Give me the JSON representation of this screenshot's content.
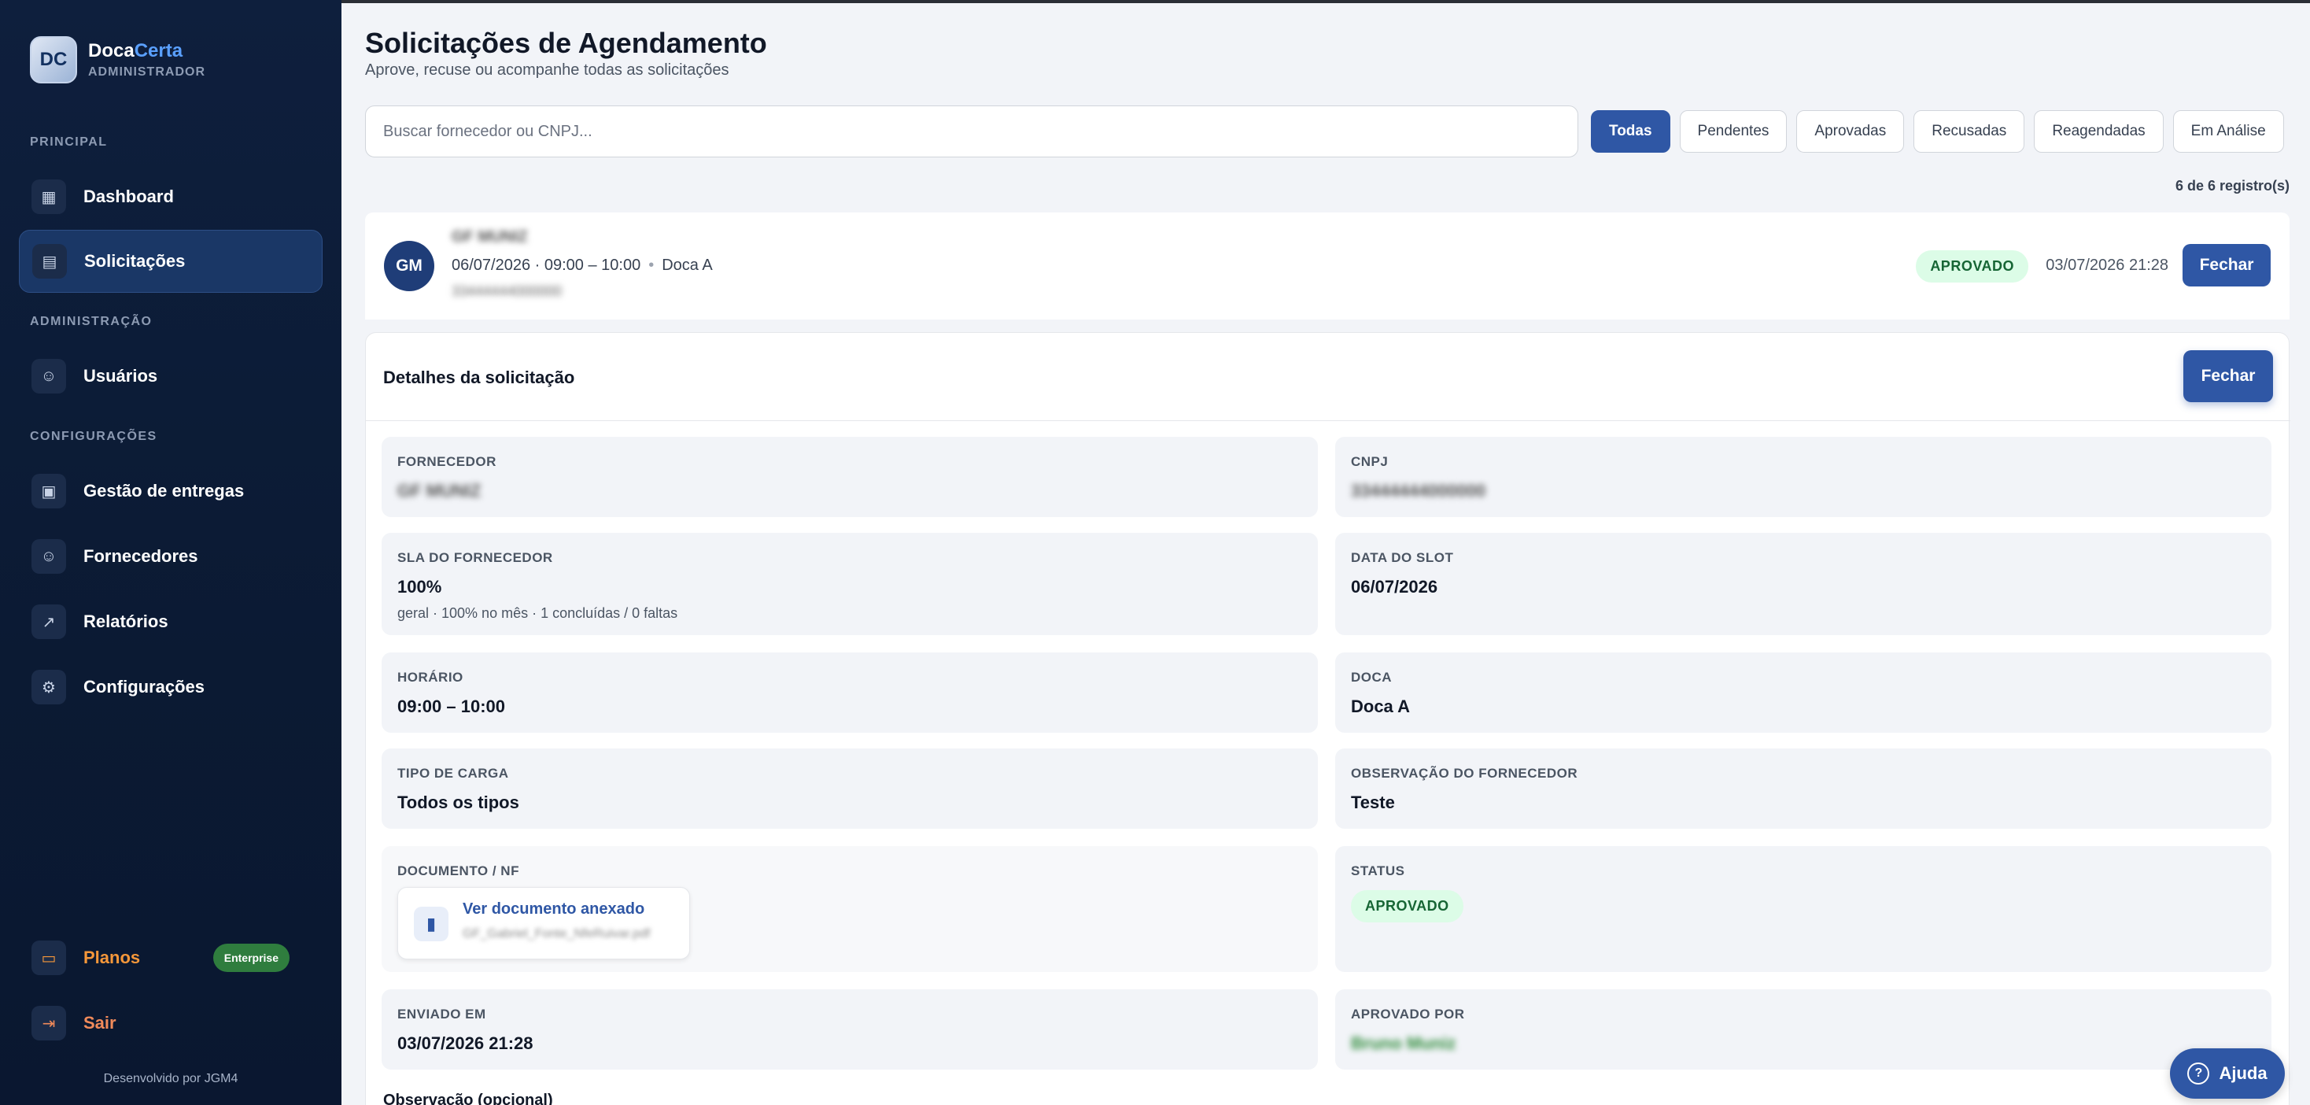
{
  "brand": {
    "name_part1": "Doca",
    "name_part2": "Certa",
    "role": "ADMINISTRADOR",
    "logo_text": "DC"
  },
  "sidebar": {
    "sections": {
      "principal": "PRINCIPAL",
      "administracao": "ADMINISTRAÇÃO",
      "configuracoes": "CONFIGURAÇÕES"
    },
    "items": [
      {
        "label": "Dashboard",
        "icon": "grid-icon"
      },
      {
        "label": "Solicitações",
        "icon": "document-icon",
        "active": true
      },
      {
        "label": "Usuários",
        "icon": "users-icon"
      },
      {
        "label": "Gestão de entregas",
        "icon": "calendar-icon"
      },
      {
        "label": "Fornecedores",
        "icon": "users-icon"
      },
      {
        "label": "Relatórios",
        "icon": "chart-icon"
      },
      {
        "label": "Configurações",
        "icon": "gear-icon"
      }
    ],
    "planos": {
      "label": "Planos",
      "badge": "Enterprise"
    },
    "sair": {
      "label": "Sair"
    },
    "credit": "Desenvolvido por JGM4"
  },
  "header": {
    "title": "Solicitações de Agendamento",
    "subtitle": "Aprove, recuse ou acompanhe todas as solicitações"
  },
  "search": {
    "placeholder": "Buscar fornecedor ou CNPJ..."
  },
  "filters": [
    "Todas",
    "Pendentes",
    "Aprovadas",
    "Recusadas",
    "Reagendadas",
    "Em Análise"
  ],
  "active_filter": "Todas",
  "count_text": "6 de 6 registro(s)",
  "request": {
    "initials": "GM",
    "name": "GF MUNIZ",
    "slot": "06/07/2026 · 09:00 – 10:00",
    "dock": "Doca A",
    "cnpj": "33444444000000",
    "status": "APROVADO",
    "datetime": "03/07/2026 21:28",
    "close_label": "Fechar"
  },
  "details": {
    "title": "Detalhes da solicitação",
    "close_label": "Fechar",
    "fornecedor": {
      "label": "FORNECEDOR",
      "value": "GF MUNIZ"
    },
    "cnpj": {
      "label": "CNPJ",
      "value": "33444444000000"
    },
    "sla": {
      "label": "SLA DO FORNECEDOR",
      "value": "100%",
      "sub": "geral · 100% no mês · 1 concluídas / 0 faltas"
    },
    "data_slot": {
      "label": "DATA DO SLOT",
      "value": "06/07/2026"
    },
    "horario": {
      "label": "HORÁRIO",
      "value": "09:00 – 10:00"
    },
    "doca": {
      "label": "DOCA",
      "value": "Doca A"
    },
    "tipo_carga": {
      "label": "TIPO DE CARGA",
      "value": "Todos os tipos"
    },
    "observacao_fornecedor": {
      "label": "OBSERVAÇÃO DO FORNECEDOR",
      "value": "Teste"
    },
    "documento": {
      "label": "DOCUMENTO / NF",
      "link": "Ver documento anexado",
      "file": "GF_Gabriel_Fonte_NfeRuivar.pdf"
    },
    "status": {
      "label": "STATUS",
      "value": "APROVADO"
    },
    "enviado_em": {
      "label": "ENVIADO EM",
      "value": "03/07/2026 21:28"
    },
    "aprovado_por": {
      "label": "APROVADO POR",
      "value": "Bruno Muniz"
    },
    "observacao_label": "Observação (opcional)"
  },
  "help": {
    "label": "Ajuda"
  },
  "colors": {
    "primary": "#2f57a5",
    "sidebar": "#0e1f3d",
    "success_bg": "#dcfce7",
    "success_text": "#166534",
    "planos": "#f5973a"
  }
}
